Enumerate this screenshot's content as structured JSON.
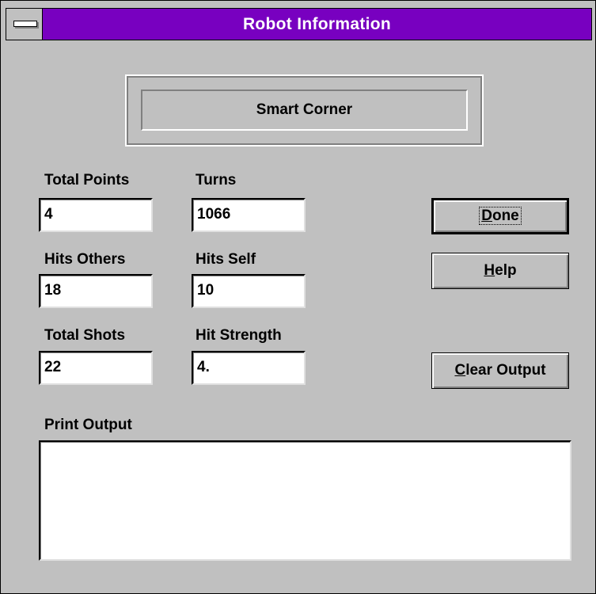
{
  "window": {
    "title": "Robot Information"
  },
  "robot_name": "Smart Corner",
  "fields": {
    "total_points": {
      "label": "Total Points",
      "value": "4"
    },
    "turns": {
      "label": "Turns",
      "value": "1066"
    },
    "hits_others": {
      "label": "Hits Others",
      "value": "18"
    },
    "hits_self": {
      "label": "Hits Self",
      "value": "10"
    },
    "total_shots": {
      "label": "Total Shots",
      "value": "22"
    },
    "hit_strength": {
      "label": "Hit Strength",
      "value": "4."
    }
  },
  "buttons": {
    "done": {
      "mnemonic": "D",
      "rest": "one"
    },
    "help": {
      "mnemonic": "H",
      "rest": "elp"
    },
    "clear_output": {
      "mnemonic": "C",
      "rest": "lear Output"
    }
  },
  "print_output": {
    "label": "Print Output",
    "text": ""
  },
  "icons": {
    "system_menu": "system-menu-icon"
  },
  "colors": {
    "titlebar": "#7800c0",
    "face": "#c0c0c0"
  }
}
